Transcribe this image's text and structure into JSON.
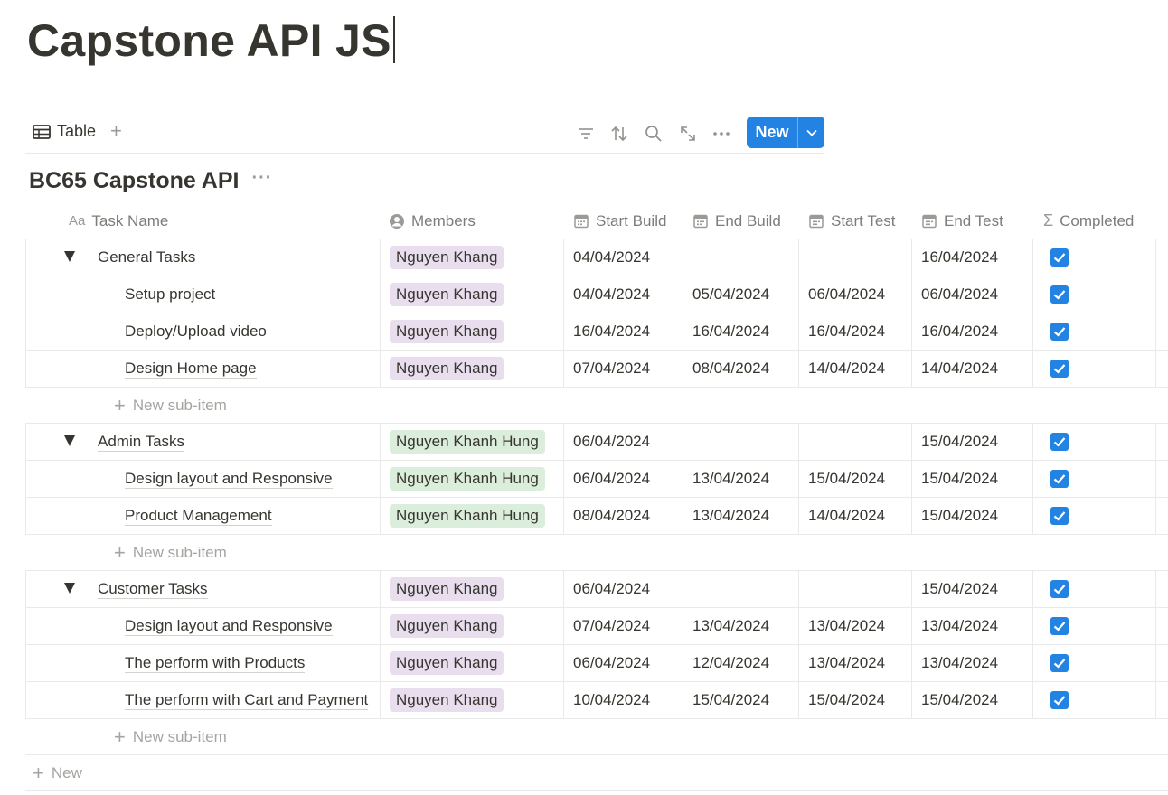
{
  "page": {
    "title": "Capstone API JS"
  },
  "toolbar": {
    "view_label": "Table",
    "new_label": "New",
    "icons": [
      "filter-icon",
      "sort-icon",
      "search-icon",
      "expand-icon",
      "more-icon"
    ]
  },
  "database": {
    "title": "BC65 Capstone API",
    "more": "···"
  },
  "columns": {
    "name": "Task Name",
    "name_icon": "Aa",
    "members": "Members",
    "start_build": "Start Build",
    "end_build": "End Build",
    "start_test": "Start Test",
    "end_test": "End Test",
    "completed": "Completed",
    "completed_icon": "Σ"
  },
  "colors": {
    "accent": "#2383e2",
    "tag_purple": "#e8deee",
    "tag_green": "#dbeddb"
  },
  "groups": [
    {
      "name": "General Tasks",
      "member": "Nguyen Khang",
      "tag_color": "purple",
      "start_build": "04/04/2024",
      "end_build": "",
      "start_test": "",
      "end_test": "16/04/2024",
      "completed": true,
      "items": [
        {
          "name": "Setup project",
          "member": "Nguyen Khang",
          "start_build": "04/04/2024",
          "end_build": "05/04/2024",
          "start_test": "06/04/2024",
          "end_test": "06/04/2024",
          "completed": true
        },
        {
          "name": "Deploy/Upload video",
          "member": "Nguyen Khang",
          "start_build": "16/04/2024",
          "end_build": "16/04/2024",
          "start_test": "16/04/2024",
          "end_test": "16/04/2024",
          "completed": true
        },
        {
          "name": "Design Home page",
          "member": "Nguyen Khang",
          "start_build": "07/04/2024",
          "end_build": "08/04/2024",
          "start_test": "14/04/2024",
          "end_test": "14/04/2024",
          "completed": true
        }
      ]
    },
    {
      "name": "Admin Tasks",
      "member": "Nguyen Khanh Hung",
      "tag_color": "green",
      "start_build": "06/04/2024",
      "end_build": "",
      "start_test": "",
      "end_test": "15/04/2024",
      "completed": true,
      "items": [
        {
          "name": "Design layout and Responsive",
          "member": "Nguyen Khanh Hung",
          "start_build": "06/04/2024",
          "end_build": "13/04/2024",
          "start_test": "15/04/2024",
          "end_test": "15/04/2024",
          "completed": true
        },
        {
          "name": "Product Management",
          "member": "Nguyen Khanh Hung",
          "start_build": "08/04/2024",
          "end_build": "13/04/2024",
          "start_test": "14/04/2024",
          "end_test": "15/04/2024",
          "completed": true
        }
      ]
    },
    {
      "name": "Customer Tasks",
      "member": "Nguyen Khang",
      "tag_color": "purple",
      "start_build": "06/04/2024",
      "end_build": "",
      "start_test": "",
      "end_test": "15/04/2024",
      "completed": true,
      "items": [
        {
          "name": "Design layout and Responsive",
          "member": "Nguyen Khang",
          "start_build": "07/04/2024",
          "end_build": "13/04/2024",
          "start_test": "13/04/2024",
          "end_test": "13/04/2024",
          "completed": true
        },
        {
          "name": "The perform with Products",
          "member": "Nguyen Khang",
          "start_build": "06/04/2024",
          "end_build": "12/04/2024",
          "start_test": "13/04/2024",
          "end_test": "13/04/2024",
          "completed": true
        },
        {
          "name": "The perform with Cart and Payment",
          "member": "Nguyen Khang",
          "start_build": "10/04/2024",
          "end_build": "15/04/2024",
          "start_test": "15/04/2024",
          "end_test": "15/04/2024",
          "completed": true
        }
      ]
    }
  ],
  "sub_item_label": "New sub-item",
  "new_row_label": "New"
}
